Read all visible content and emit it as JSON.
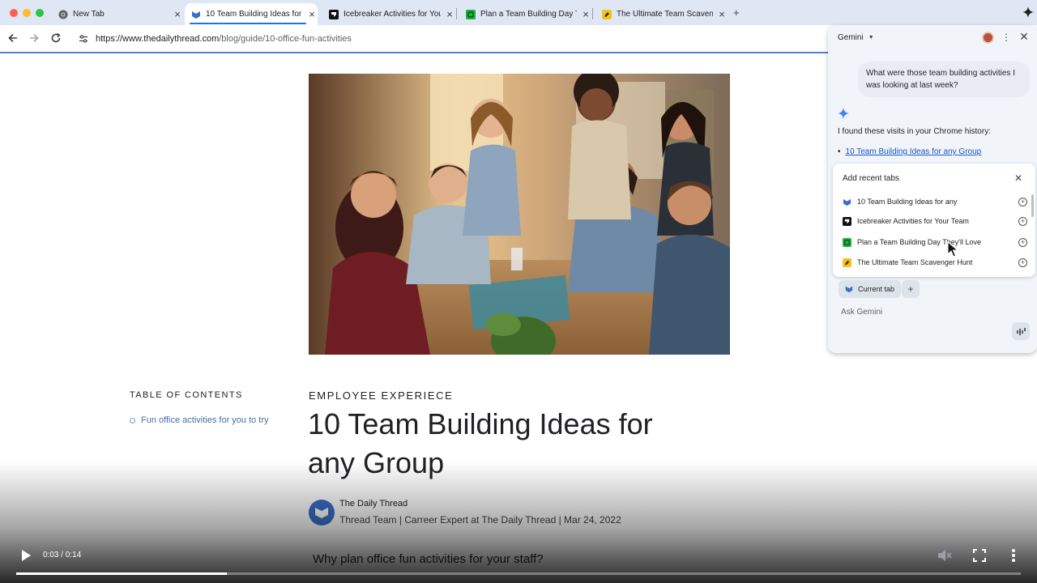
{
  "tabs": [
    {
      "label": "New Tab",
      "favicon": "chrome-icon",
      "active": false
    },
    {
      "label": "10 Team Building Ideas for any Group",
      "favicon": "daily-thread-icon",
      "active": true
    },
    {
      "label": "Icebreaker Activities for Your Team",
      "favicon": "icebreaker-icon",
      "active": false
    },
    {
      "label": "Plan a Team Building Day They'll Love",
      "favicon": "plan-icon",
      "active": false
    },
    {
      "label": "The Ultimate Team Scavenger Hunt",
      "favicon": "scavenger-icon",
      "active": false
    }
  ],
  "toolbar": {
    "new_tab": "+",
    "url_host": "https://www.thedailythread.com",
    "url_path": "/blog/guide/10-office-fun-activities"
  },
  "article": {
    "toc_title": "TABLE OF CONTENTS",
    "toc_items": [
      "Fun office activities for you to try"
    ],
    "eyebrow": "EMPLOYEE EXPERIECE",
    "title": "10 Team Building Ideas for any Group",
    "author_name": "The Daily Thread",
    "author_meta": "Thread Team | Carreer Expert at The Daily Thread | Mar 24, 2022",
    "next_heading": "Why plan office fun activities for your staff?"
  },
  "video": {
    "time": "0:03 / 0:14",
    "progress": 0.21
  },
  "gemini": {
    "title": "Gemini",
    "user_message": "What were those team building activities I was looking at last week?",
    "reply": "I found these visits in your Chrome history:",
    "link": "10 Team Building Ideas for any Group",
    "recent_title": "Add recent tabs",
    "recent_items": [
      {
        "label": "10 Team Building Ideas for any",
        "favicon": "daily-thread-icon"
      },
      {
        "label": "Icebreaker Activities for Your Team",
        "favicon": "icebreaker-icon"
      },
      {
        "label": "Plan a Team Building Day They'll Love",
        "favicon": "plan-icon"
      },
      {
        "label": "The Ultimate Team Scavenger Hunt",
        "favicon": "scavenger-icon"
      }
    ],
    "chip_label": "Current tab",
    "chip_add": "+",
    "input_placeholder": "Ask Gemini"
  },
  "colors": {
    "tabstrip": "#dfe6f4",
    "accent": "#1a73e8",
    "link": "#1a57c4",
    "panel": "#f1f4f9",
    "icebreaker": "#111111",
    "plan": "#1db43d",
    "scavenger": "#f4c21a",
    "daily_thread": "#3a6fc8"
  }
}
